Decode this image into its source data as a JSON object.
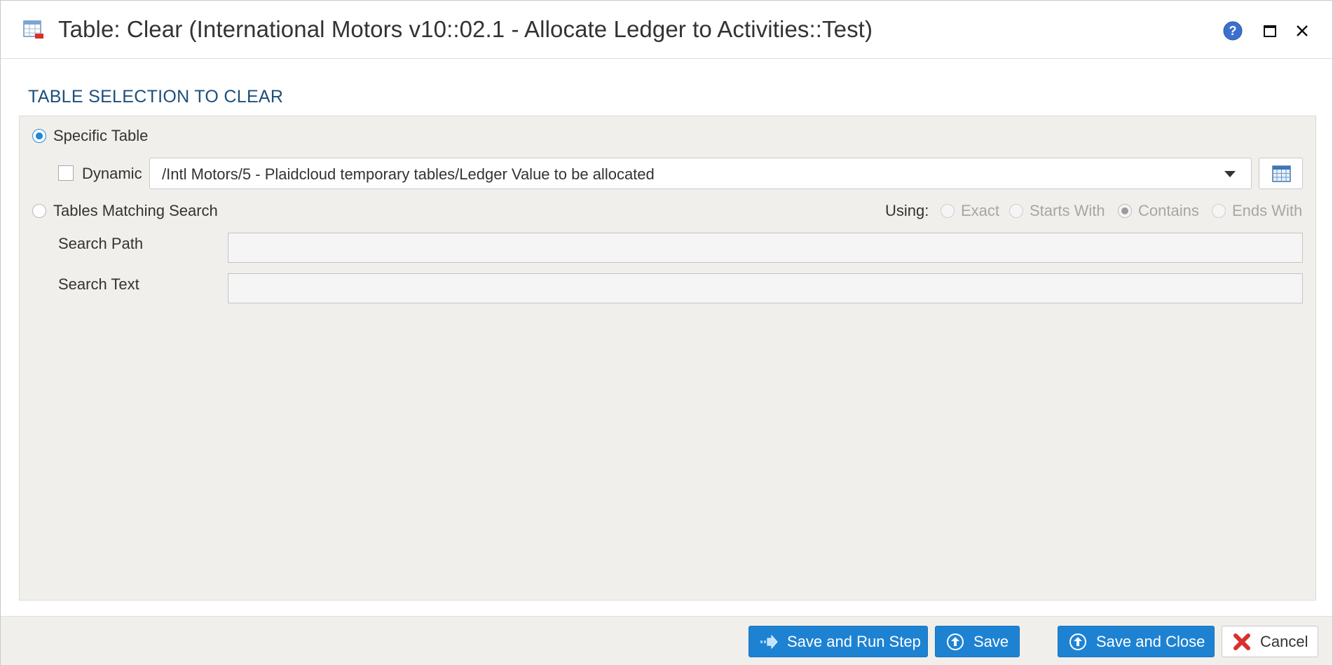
{
  "window": {
    "title": "Table: Clear (International Motors v10::02.1 - Allocate Ledger to Activities::Test)"
  },
  "section": {
    "title": "TABLE SELECTION TO CLEAR"
  },
  "specific_table": {
    "label": "Specific Table",
    "selected": true,
    "dynamic_label": "Dynamic",
    "dynamic_checked": false,
    "selected_table": "/Intl Motors/5 - Plaidcloud temporary tables/Ledger Value to be allocated"
  },
  "tables_matching": {
    "label": "Tables Matching Search",
    "selected": false,
    "using_label": "Using:",
    "match_options": [
      {
        "label": "Exact",
        "selected": false
      },
      {
        "label": "Starts With",
        "selected": false
      },
      {
        "label": "Contains",
        "selected": true
      },
      {
        "label": "Ends With",
        "selected": false
      }
    ],
    "search_path_label": "Search Path",
    "search_path_value": "",
    "search_text_label": "Search Text",
    "search_text_value": ""
  },
  "footer": {
    "save_run_label": "Save and Run Step",
    "save_label": "Save",
    "save_close_label": "Save and Close",
    "cancel_label": "Cancel"
  },
  "colors": {
    "accent": "#1e82d2",
    "section_title": "#1d4f7a",
    "panel_bg": "#f0efec",
    "cancel_icon": "#d9302c"
  }
}
